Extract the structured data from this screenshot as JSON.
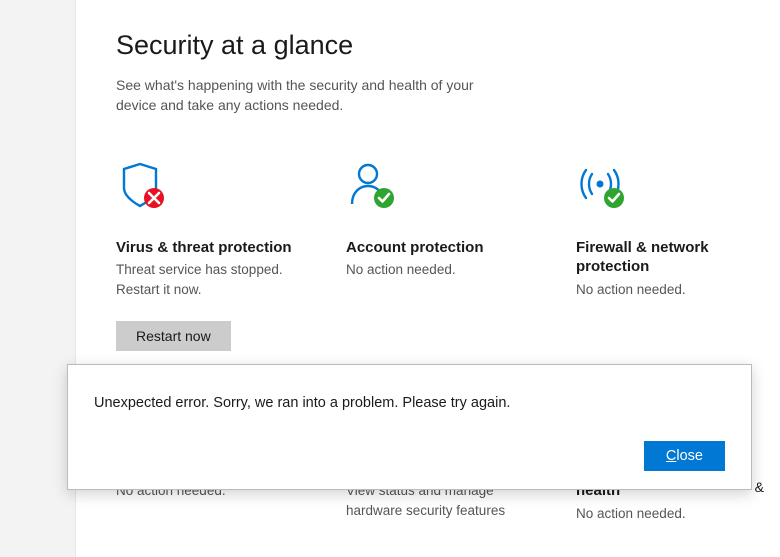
{
  "header": {
    "title": "Security at a glance",
    "subtitle": "See what's happening with the security and health of your device and take any actions needed."
  },
  "tiles": {
    "virus": {
      "title": "Virus & threat protection",
      "status": "Threat service has stopped. Restart it now.",
      "button": "Restart now"
    },
    "account": {
      "title": "Account protection",
      "status": "No action needed."
    },
    "firewall": {
      "title": "Firewall & network protection",
      "status": "No action needed."
    }
  },
  "lower": {
    "left": {
      "status": "No action needed."
    },
    "middle": {
      "status": "View status and manage hardware security features"
    },
    "right": {
      "title": "health",
      "status": "No action needed."
    }
  },
  "dialog": {
    "message": "Unexpected error. Sorry, we ran into a problem.  Please try again.",
    "close": "Close"
  },
  "colors": {
    "accent": "#0078d4",
    "ok": "#2fa52f",
    "error": "#e81123"
  },
  "fragment": "&"
}
